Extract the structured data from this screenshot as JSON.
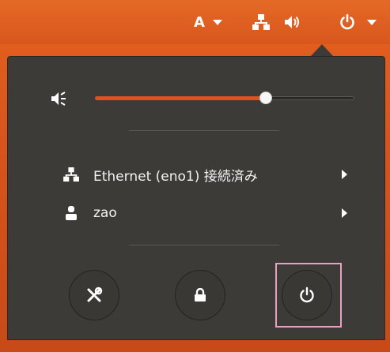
{
  "topbar": {
    "input_method_label": "A",
    "icons": [
      "input-method-caret-icon",
      "network-wired-icon",
      "volume-high-icon",
      "power-icon",
      "system-menu-caret-icon"
    ]
  },
  "menu": {
    "volume": {
      "icon": "volume-icon",
      "level": 0.66
    },
    "ethernet": {
      "icon": "network-wired-icon",
      "label": "Ethernet (eno1) 接続済み"
    },
    "user": {
      "icon": "user-icon",
      "label": "zao"
    },
    "actions": [
      {
        "name": "settings",
        "icon": "settings-tools-icon"
      },
      {
        "name": "lock",
        "icon": "lock-icon"
      },
      {
        "name": "power-off",
        "icon": "power-icon"
      }
    ]
  },
  "colors": {
    "accent": "#e0521d",
    "menu_bg": "#3d3b38",
    "highlight": "#e8a0c3"
  }
}
